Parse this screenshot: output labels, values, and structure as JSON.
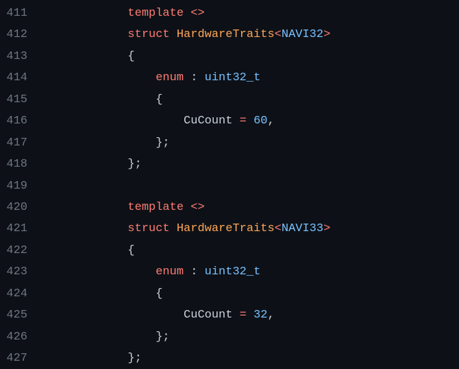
{
  "lines": [
    {
      "num": "411",
      "tokens": [
        {
          "cls": "punc",
          "t": "            "
        },
        {
          "cls": "kw",
          "t": "template"
        },
        {
          "cls": "punc",
          "t": " "
        },
        {
          "cls": "op",
          "t": "<>"
        }
      ]
    },
    {
      "num": "412",
      "tokens": [
        {
          "cls": "punc",
          "t": "            "
        },
        {
          "cls": "kw",
          "t": "struct"
        },
        {
          "cls": "punc",
          "t": " "
        },
        {
          "cls": "cls",
          "t": "HardwareTraits"
        },
        {
          "cls": "op",
          "t": "<"
        },
        {
          "cls": "type",
          "t": "NAVI32"
        },
        {
          "cls": "op",
          "t": ">"
        }
      ]
    },
    {
      "num": "413",
      "tokens": [
        {
          "cls": "punc",
          "t": "            {"
        }
      ]
    },
    {
      "num": "414",
      "tokens": [
        {
          "cls": "punc",
          "t": "                "
        },
        {
          "cls": "kw",
          "t": "enum"
        },
        {
          "cls": "punc",
          "t": " : "
        },
        {
          "cls": "type",
          "t": "uint32_t"
        }
      ]
    },
    {
      "num": "415",
      "tokens": [
        {
          "cls": "punc",
          "t": "                {"
        }
      ]
    },
    {
      "num": "416",
      "tokens": [
        {
          "cls": "punc",
          "t": "                    "
        },
        {
          "cls": "id",
          "t": "CuCount"
        },
        {
          "cls": "punc",
          "t": " "
        },
        {
          "cls": "op",
          "t": "="
        },
        {
          "cls": "punc",
          "t": " "
        },
        {
          "cls": "num",
          "t": "60"
        },
        {
          "cls": "punc",
          "t": ","
        }
      ]
    },
    {
      "num": "417",
      "tokens": [
        {
          "cls": "punc",
          "t": "                };"
        }
      ]
    },
    {
      "num": "418",
      "tokens": [
        {
          "cls": "punc",
          "t": "            };"
        }
      ]
    },
    {
      "num": "419",
      "tokens": [
        {
          "cls": "punc",
          "t": ""
        }
      ]
    },
    {
      "num": "420",
      "tokens": [
        {
          "cls": "punc",
          "t": "            "
        },
        {
          "cls": "kw",
          "t": "template"
        },
        {
          "cls": "punc",
          "t": " "
        },
        {
          "cls": "op",
          "t": "<>"
        }
      ]
    },
    {
      "num": "421",
      "tokens": [
        {
          "cls": "punc",
          "t": "            "
        },
        {
          "cls": "kw",
          "t": "struct"
        },
        {
          "cls": "punc",
          "t": " "
        },
        {
          "cls": "cls",
          "t": "HardwareTraits"
        },
        {
          "cls": "op",
          "t": "<"
        },
        {
          "cls": "type",
          "t": "NAVI33"
        },
        {
          "cls": "op",
          "t": ">"
        }
      ]
    },
    {
      "num": "422",
      "tokens": [
        {
          "cls": "punc",
          "t": "            {"
        }
      ]
    },
    {
      "num": "423",
      "tokens": [
        {
          "cls": "punc",
          "t": "                "
        },
        {
          "cls": "kw",
          "t": "enum"
        },
        {
          "cls": "punc",
          "t": " : "
        },
        {
          "cls": "type",
          "t": "uint32_t"
        }
      ]
    },
    {
      "num": "424",
      "tokens": [
        {
          "cls": "punc",
          "t": "                {"
        }
      ]
    },
    {
      "num": "425",
      "tokens": [
        {
          "cls": "punc",
          "t": "                    "
        },
        {
          "cls": "id",
          "t": "CuCount"
        },
        {
          "cls": "punc",
          "t": " "
        },
        {
          "cls": "op",
          "t": "="
        },
        {
          "cls": "punc",
          "t": " "
        },
        {
          "cls": "num",
          "t": "32"
        },
        {
          "cls": "punc",
          "t": ","
        }
      ]
    },
    {
      "num": "426",
      "tokens": [
        {
          "cls": "punc",
          "t": "                };"
        }
      ]
    },
    {
      "num": "427",
      "tokens": [
        {
          "cls": "punc",
          "t": "            };"
        }
      ]
    }
  ]
}
